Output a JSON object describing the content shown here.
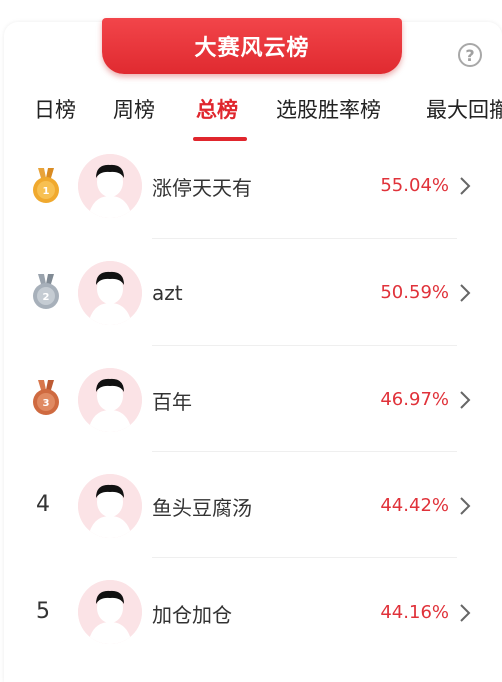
{
  "header": {
    "title": "大赛风云榜"
  },
  "tabs": [
    {
      "label": "日榜"
    },
    {
      "label": "周榜"
    },
    {
      "label": "总榜"
    },
    {
      "label": "选股胜率榜"
    },
    {
      "label": "最大回撤"
    }
  ],
  "active_tab": "总榜",
  "help_icon": "?",
  "colors": {
    "accent": "#e0262d",
    "gold": "#e79a1c",
    "silver": "#9aa3ad",
    "bronze": "#c9643c"
  },
  "leaderboard": [
    {
      "rank": "1",
      "medal": "gold-medal-icon",
      "name": "涨停天天有",
      "rate": "55.04%"
    },
    {
      "rank": "2",
      "medal": "silver-medal-icon",
      "name": "azt",
      "rate": "50.59%"
    },
    {
      "rank": "3",
      "medal": "bronze-medal-icon",
      "name": "百年",
      "rate": "46.97%"
    },
    {
      "rank": "4",
      "medal": "",
      "name": "鱼头豆腐汤",
      "rate": "44.42%"
    },
    {
      "rank": "5",
      "medal": "",
      "name": "加仓加仓",
      "rate": "44.16%"
    }
  ]
}
